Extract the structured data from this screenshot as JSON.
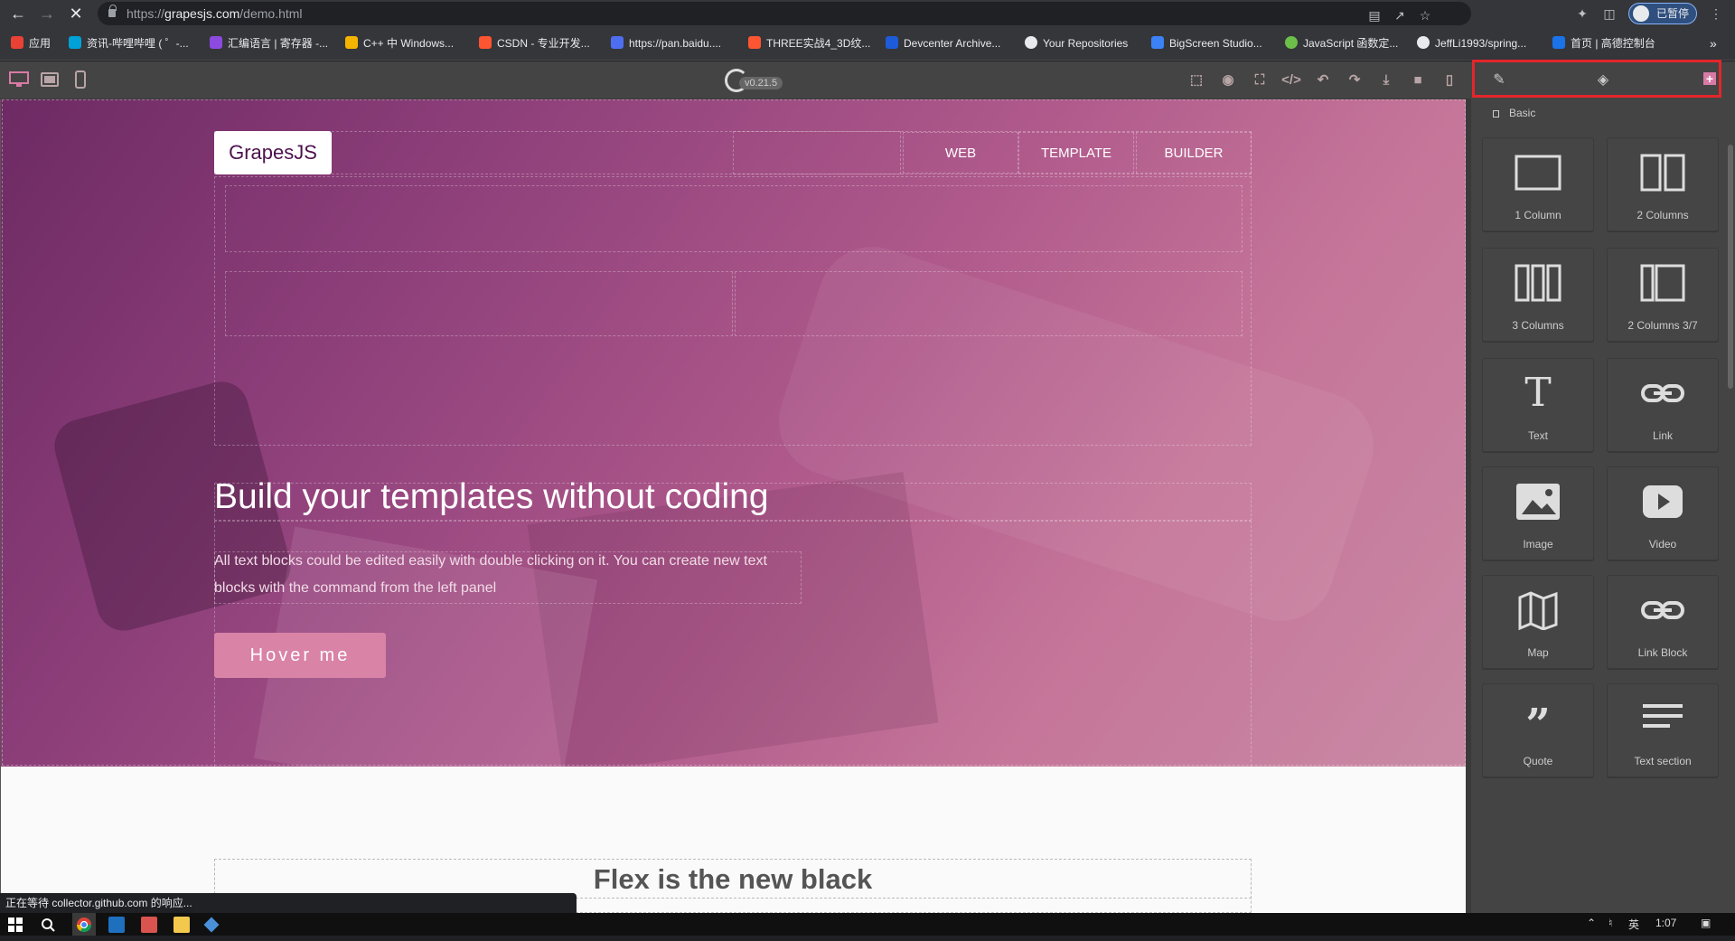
{
  "browser": {
    "url_prefix": "https://",
    "url_domain": "grapesjs.com",
    "url_path": "/demo.html",
    "profile_label": "已暂停"
  },
  "bookmarks": [
    {
      "label": "应用",
      "color": "#e94235"
    },
    {
      "label": "资讯-哔哩哔哩 ( ゜-...",
      "color": "#00a1d6"
    },
    {
      "label": "汇编语言 | 寄存器 -...",
      "color": "#8c4ae0"
    },
    {
      "label": "C++ 中 Windows...",
      "color": "#f4b400"
    },
    {
      "label": "CSDN - 专业开发...",
      "color": "#fc5531"
    },
    {
      "label": "https://pan.baidu....",
      "color": "#4e6ef2"
    },
    {
      "label": "THREE实战4_3D纹...",
      "color": "#fc5531"
    },
    {
      "label": "Devcenter Archive...",
      "color": "#1e5bd8"
    },
    {
      "label": "Your Repositories",
      "color": "#e8eaed"
    },
    {
      "label": "BigScreen Studio...",
      "color": "#3b82f6"
    },
    {
      "label": "JavaScript 函数定...",
      "color": "#6cc04a"
    },
    {
      "label": "JeffLi1993/spring...",
      "color": "#e8eaed"
    },
    {
      "label": "首页 | 高德控制台",
      "color": "#1a73e8"
    }
  ],
  "editor": {
    "version": "v0.21.5",
    "accent": "#d97aa6",
    "highlight_color": "#e3262b"
  },
  "hero": {
    "brand": "GrapesJS",
    "menu": [
      "WEB",
      "TEMPLATE",
      "BUILDER"
    ],
    "title": "Build your templates without coding",
    "text": "All text blocks could be edited easily with double clicking on it. You can create new text blocks with the command from the left panel",
    "button": "Hover me"
  },
  "section2": {
    "title": "Flex is the new black"
  },
  "blocks": {
    "category": "Basic",
    "items": [
      {
        "label": "1 Column",
        "icon": "one-column-icon"
      },
      {
        "label": "2 Columns",
        "icon": "two-columns-icon"
      },
      {
        "label": "3 Columns",
        "icon": "three-columns-icon"
      },
      {
        "label": "2 Columns 3/7",
        "icon": "two-columns-3-7-icon"
      },
      {
        "label": "Text",
        "icon": "text-icon"
      },
      {
        "label": "Link",
        "icon": "link-icon"
      },
      {
        "label": "Image",
        "icon": "image-icon"
      },
      {
        "label": "Video",
        "icon": "video-icon"
      },
      {
        "label": "Map",
        "icon": "map-icon"
      },
      {
        "label": "Link Block",
        "icon": "link-block-icon"
      },
      {
        "label": "Quote",
        "icon": "quote-icon"
      },
      {
        "label": "Text section",
        "icon": "text-section-icon"
      }
    ]
  },
  "status": {
    "text": "正在等待 collector.github.com 的响应..."
  },
  "tray": {
    "ime": "英",
    "time": "1:07"
  }
}
